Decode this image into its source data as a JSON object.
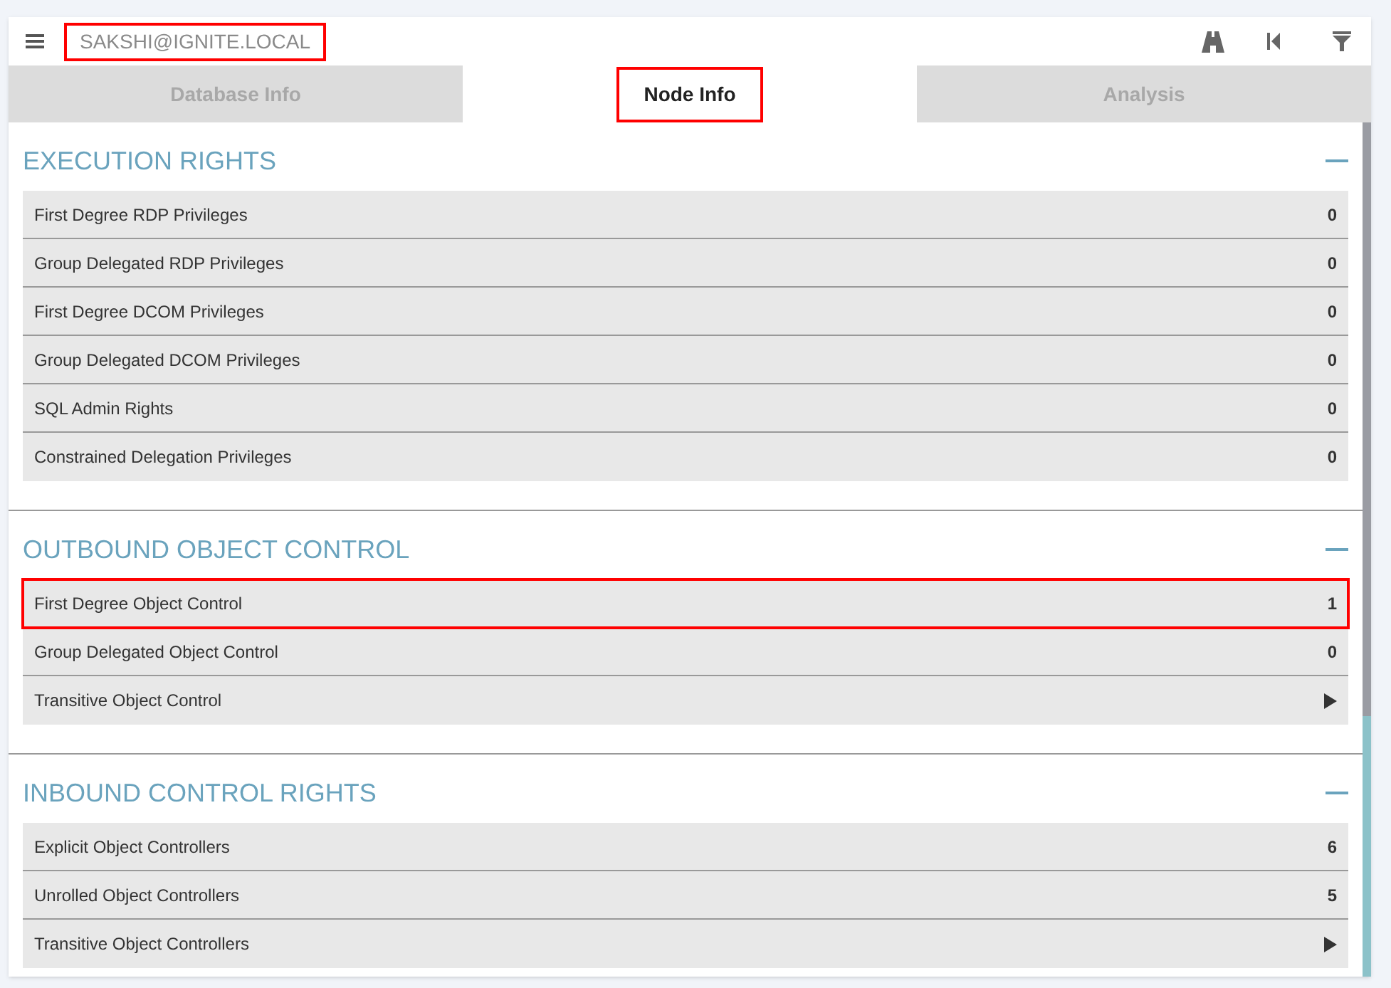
{
  "header": {
    "title": "SAKSHI@IGNITE.LOCAL",
    "annotated": true
  },
  "tabs": [
    {
      "label": "Database Info",
      "selected": false,
      "annotated": false
    },
    {
      "label": "Node Info",
      "selected": true,
      "annotated": true
    },
    {
      "label": "Analysis",
      "selected": false,
      "annotated": false
    }
  ],
  "sections": [
    {
      "title": "EXECUTION RIGHTS",
      "expanded": true,
      "rows": [
        {
          "kind": "count",
          "label": "First Degree RDP Privileges",
          "value": "0",
          "annotated": false
        },
        {
          "kind": "count",
          "label": "Group Delegated RDP Privileges",
          "value": "0",
          "annotated": false
        },
        {
          "kind": "count",
          "label": "First Degree DCOM Privileges",
          "value": "0",
          "annotated": false
        },
        {
          "kind": "count",
          "label": "Group Delegated DCOM Privileges",
          "value": "0",
          "annotated": false
        },
        {
          "kind": "count",
          "label": "SQL Admin Rights",
          "value": "0",
          "annotated": false
        },
        {
          "kind": "count",
          "label": "Constrained Delegation Privileges",
          "value": "0",
          "annotated": false
        }
      ]
    },
    {
      "title": "OUTBOUND OBJECT CONTROL",
      "expanded": true,
      "rows": [
        {
          "kind": "count",
          "label": "First Degree Object Control",
          "value": "1",
          "annotated": true
        },
        {
          "kind": "count",
          "label": "Group Delegated Object Control",
          "value": "0",
          "annotated": false
        },
        {
          "kind": "expand",
          "label": "Transitive Object Control",
          "annotated": false
        }
      ]
    },
    {
      "title": "INBOUND CONTROL RIGHTS",
      "expanded": true,
      "rows": [
        {
          "kind": "count",
          "label": "Explicit Object Controllers",
          "value": "6",
          "annotated": false
        },
        {
          "kind": "count",
          "label": "Unrolled Object Controllers",
          "value": "5",
          "annotated": false
        },
        {
          "kind": "expand",
          "label": "Transitive Object Controllers",
          "annotated": false
        }
      ]
    }
  ]
}
